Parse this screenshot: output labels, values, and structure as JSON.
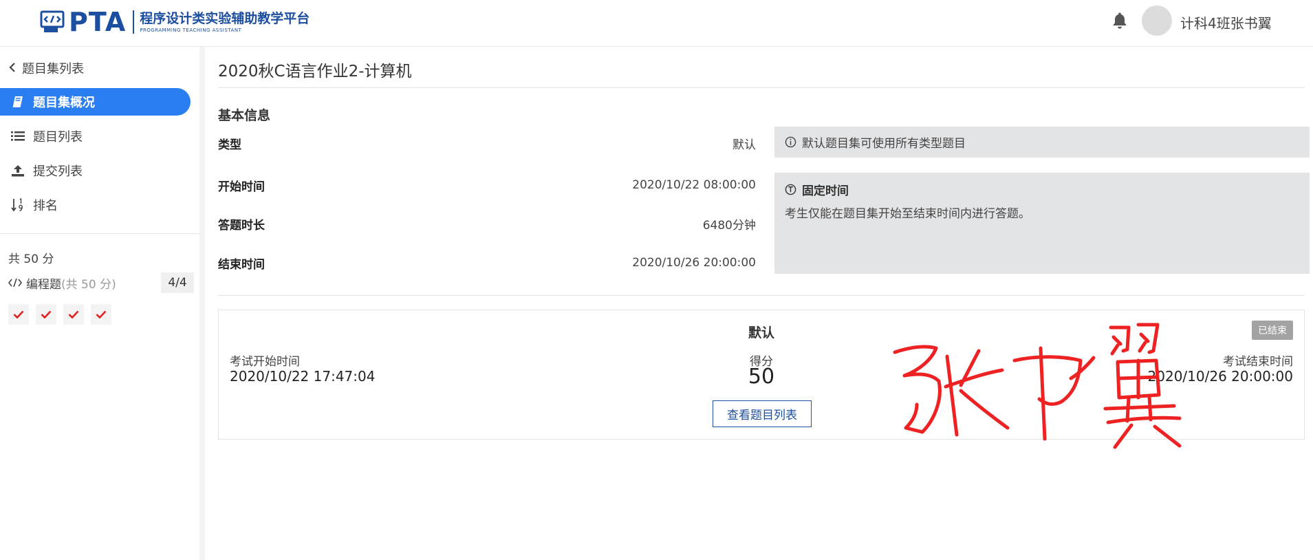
{
  "header": {
    "logo_text": "PTA",
    "logo_cn": "程序设计类实验辅助教学平台",
    "logo_en": "PROGRAMMING TEACHING ASSISTANT",
    "username": "计科4班张书翼",
    "brand_color": "#1d4fa1"
  },
  "sidebar": {
    "back_label": "题目集列表",
    "items": [
      {
        "label": "题目集概况",
        "icon": "book-icon",
        "active": true
      },
      {
        "label": "题目列表",
        "icon": "list-icon",
        "active": false
      },
      {
        "label": "提交列表",
        "icon": "upload-icon",
        "active": false
      },
      {
        "label": "排名",
        "icon": "sort-numeric-icon",
        "active": false
      }
    ],
    "total": "共 50 分",
    "category": {
      "label": "编程题",
      "sub": "(共 50 分)",
      "progress": "4/4"
    },
    "problem_status_count": 4,
    "active_color": "#2a7ef0"
  },
  "main": {
    "title": "2020秋C语言作业2-计算机",
    "section_title": "基本信息",
    "info": [
      {
        "key": "类型",
        "value": "默认"
      },
      {
        "key": "开始时间",
        "value": "2020/10/22 08:00:00"
      },
      {
        "key": "答题时长",
        "value": "6480分钟"
      },
      {
        "key": "结束时间",
        "value": "2020/10/26 20:00:00"
      }
    ],
    "hint_type": "默认题目集可使用所有类型题目",
    "hint_time_title": "固定时间",
    "hint_time_body": "考生仅能在题目集开始至结束时间内进行答题。",
    "card": {
      "title": "默认",
      "status": "已结束",
      "start_label": "考试开始时间",
      "start_value": "2020/10/22 17:47:04",
      "score_label": "得分",
      "score_value": "50",
      "end_label": "考试结束时间",
      "end_value": "2020/10/26 20:00:00",
      "button_label": "查看题目列表"
    },
    "signature_color": "#ee2222"
  }
}
